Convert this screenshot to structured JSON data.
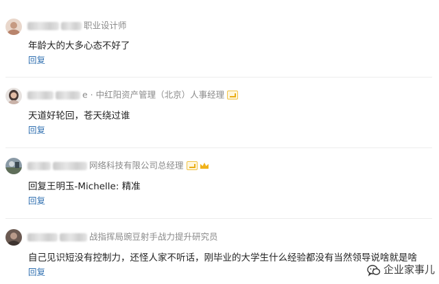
{
  "comments": [
    {
      "author_title": "职业设计师",
      "text": "年龄大的大多心态不好了",
      "reply_label": "回复"
    },
    {
      "author_suffix": "e · 中红阳资产管理（北京）人事经理",
      "text": "天道好轮回，苍天绕过谁",
      "reply_label": "回复"
    },
    {
      "author_title": "网络科技有限公司总经理",
      "text": "回复王明玉-Michelle: 精准",
      "reply_label": "回复"
    },
    {
      "author_title": "战指挥局豌豆射手战力提升研究员",
      "text": "自己见识短没有控制力，还怪人家不听话，刚毕业的大学生什么经验都没有当然领导说啥就是啥",
      "reply_label": "回复"
    }
  ],
  "watermark": {
    "label": "企业家事儿",
    "icon": "wechat-bubble-icon"
  },
  "colors": {
    "reply_link": "#2f6fb0",
    "meta_text": "#8a8a8a",
    "badge_gold": "#f0c243"
  }
}
